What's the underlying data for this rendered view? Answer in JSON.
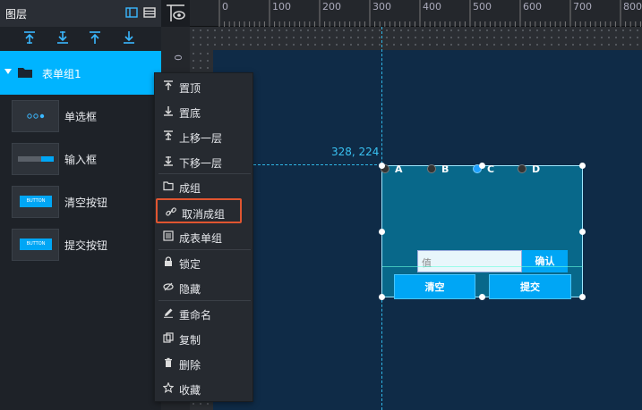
{
  "panel": {
    "title": "图层",
    "group_label": "表单组1",
    "layers": [
      {
        "name": "单选框",
        "thumb": "radio-group"
      },
      {
        "name": "输入框",
        "thumb": "input"
      },
      {
        "name": "清空按钮",
        "thumb": "button"
      },
      {
        "name": "提交按钮",
        "thumb": "button"
      }
    ],
    "thumb_button_text": "BUTTON"
  },
  "ruler": {
    "ticks": [
      "0",
      "100",
      "200",
      "300",
      "400",
      "500",
      "600",
      "700",
      "800"
    ],
    "left_tick": "0"
  },
  "canvas": {
    "coord_readout": "328, 224",
    "radios": [
      {
        "label": "A",
        "selected": false
      },
      {
        "label": "B",
        "selected": false
      },
      {
        "label": "C",
        "selected": true
      },
      {
        "label": "D",
        "selected": false
      }
    ],
    "input_placeholder": "值",
    "confirm_label": "确认",
    "clear_label": "清空",
    "submit_label": "提交"
  },
  "menu": {
    "items": [
      {
        "label": "置顶",
        "icon": "to-top-icon"
      },
      {
        "label": "置底",
        "icon": "to-bottom-icon"
      },
      {
        "label": "上移一层",
        "icon": "move-up-icon"
      },
      {
        "label": "下移一层",
        "icon": "move-down-icon"
      },
      {
        "label": "成组",
        "icon": "folder-icon"
      },
      {
        "label": "取消成组",
        "icon": "unlink-icon",
        "highlighted": true
      },
      {
        "label": "成表单组",
        "icon": "form-icon"
      },
      {
        "label": "锁定",
        "icon": "lock-icon"
      },
      {
        "label": "隐藏",
        "icon": "eye-off-icon"
      },
      {
        "label": "重命名",
        "icon": "pencil-icon"
      },
      {
        "label": "复制",
        "icon": "copy-icon"
      },
      {
        "label": "删除",
        "icon": "trash-icon"
      },
      {
        "label": "收藏",
        "icon": "star-icon"
      }
    ]
  },
  "colors": {
    "accent": "#00b4ff",
    "highlight_border": "#e05530",
    "guide": "#2fb6e6"
  }
}
